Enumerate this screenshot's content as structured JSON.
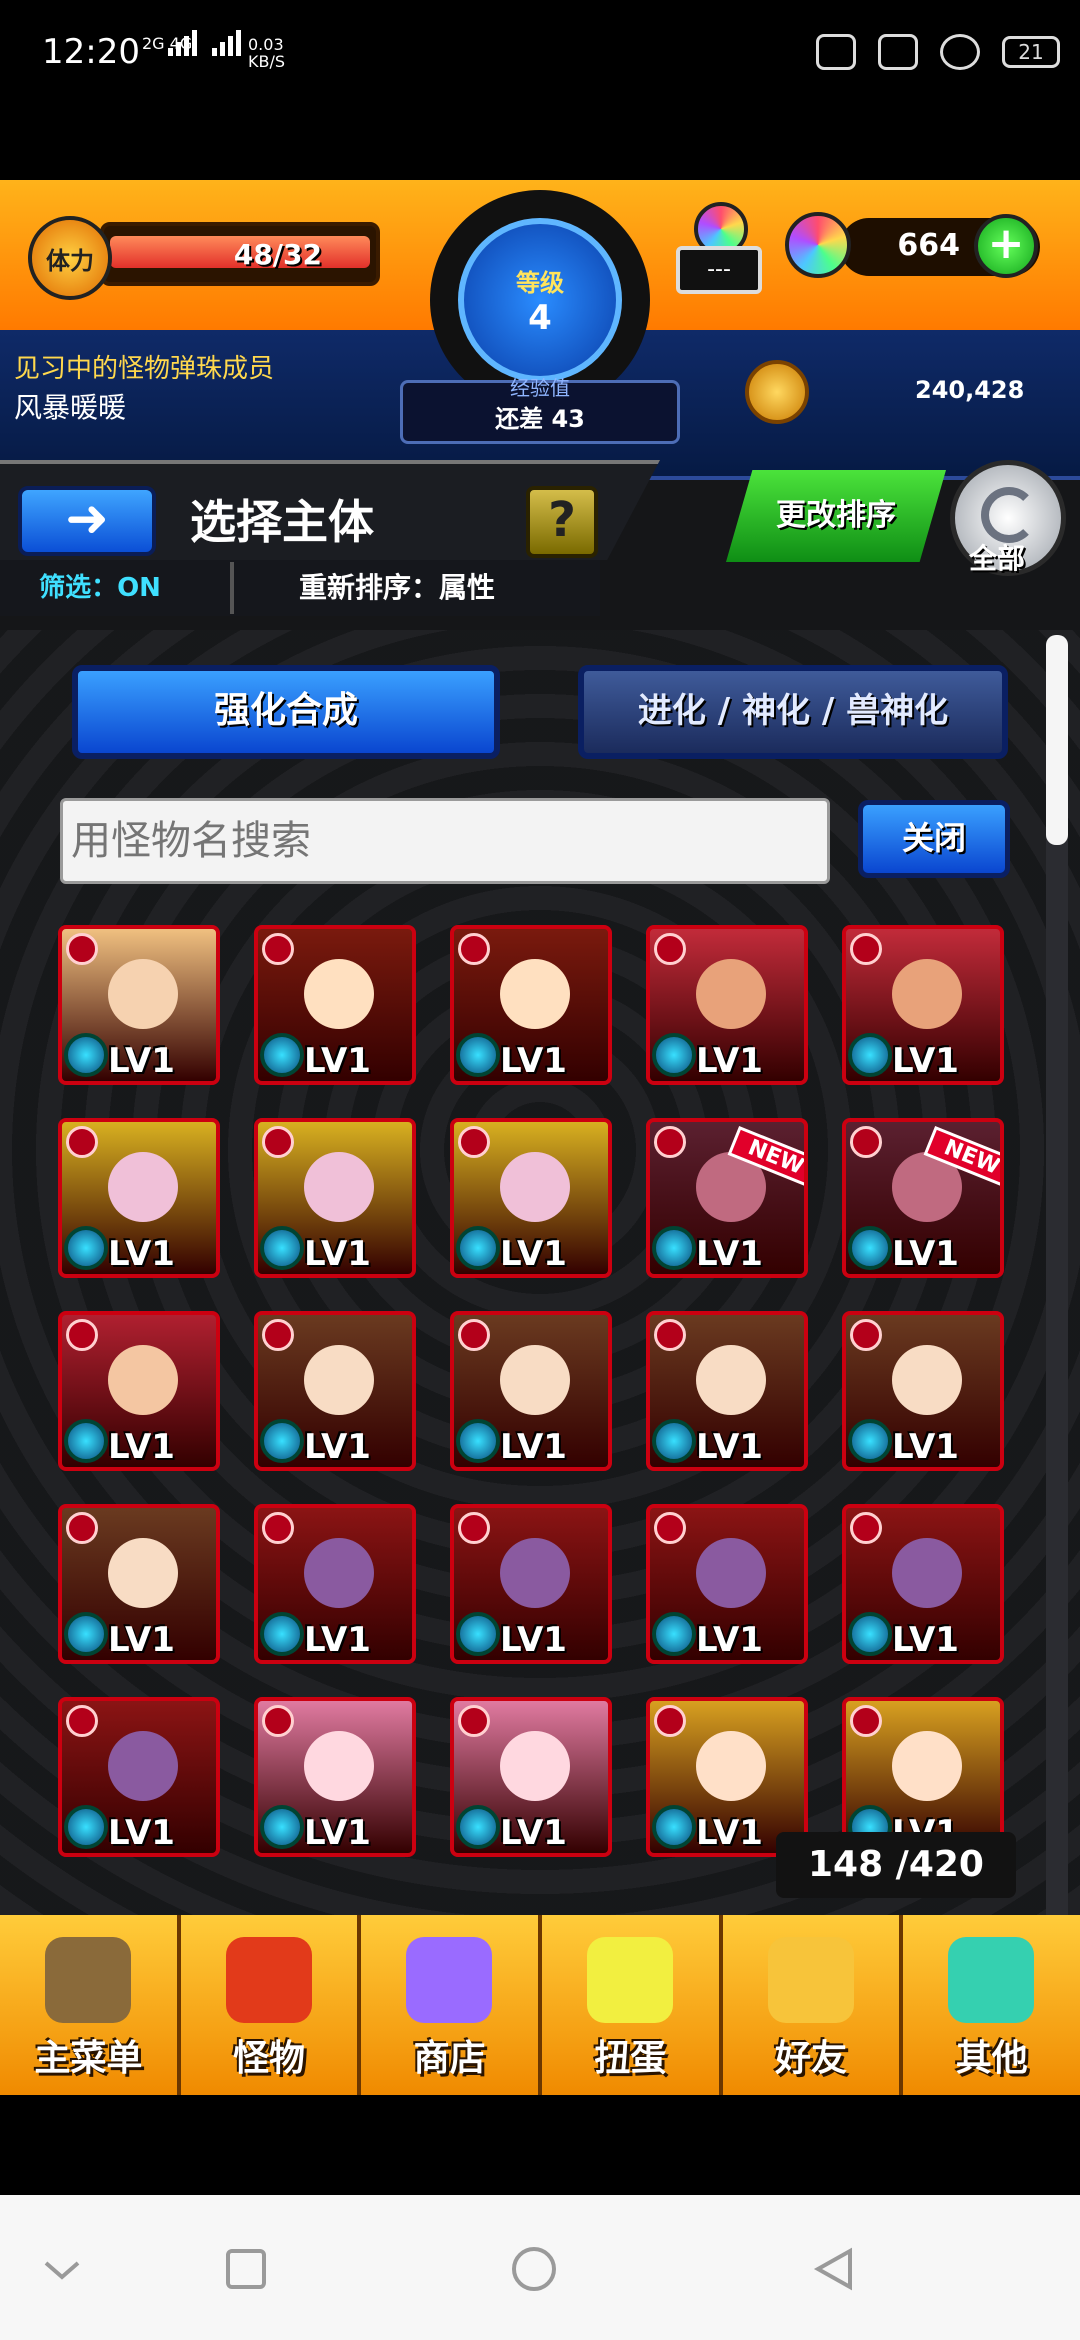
{
  "status_bar": {
    "time": "12:20",
    "network": "2G 4G",
    "speed_value": "0.03",
    "speed_unit": "KB/S",
    "battery": "21"
  },
  "hud": {
    "stamina_label": "体力",
    "stamina_value": "48/32",
    "level_label": "等级",
    "level_value": "4",
    "exp_label": "经验值",
    "exp_value": "还差 43",
    "lock_value": "---",
    "gems": "664",
    "gems_plus": "+",
    "member_title": "见习中的怪物弹珠成员",
    "player_name": "风暴暖暖",
    "coins": "240,428"
  },
  "header": {
    "back_icon": "back-arrow-icon",
    "title": "选择主体",
    "help": "?",
    "filter": "筛选：ON",
    "sort": "重新排序：属性",
    "reorder_button": "更改排序",
    "refresh_label": "全部"
  },
  "tabs": {
    "enhance": "强化合成",
    "evolve": "进化 / 神化 / 兽神化"
  },
  "search": {
    "placeholder": "用怪物名搜索",
    "close": "关闭"
  },
  "monsters": [
    {
      "level": "LV1",
      "bg": "#f0c080",
      "face": "#f6d2b0"
    },
    {
      "level": "LV1",
      "bg": "#7a1a0e",
      "face": "#ffe0c0"
    },
    {
      "level": "LV1",
      "bg": "#7a1a0e",
      "face": "#ffe0c0"
    },
    {
      "level": "LV1",
      "bg": "#c22b3a",
      "face": "#e8a27a"
    },
    {
      "level": "LV1",
      "bg": "#c22b3a",
      "face": "#e8a27a"
    },
    {
      "level": "LV1",
      "bg": "#d8b020",
      "face": "#f0c0d8"
    },
    {
      "level": "LV1",
      "bg": "#d8b020",
      "face": "#f0c0d8"
    },
    {
      "level": "LV1",
      "bg": "#d8b020",
      "face": "#f0c0d8"
    },
    {
      "level": "LV1",
      "bg": "#5b2030",
      "face": "#c06a80",
      "new": "NEW"
    },
    {
      "level": "LV1",
      "bg": "#5b2030",
      "face": "#c06a80",
      "new": "NEW"
    },
    {
      "level": "LV1",
      "bg": "#b02030",
      "face": "#f4c6a2"
    },
    {
      "level": "LV1",
      "bg": "#6a3a20",
      "face": "#f8dcc4"
    },
    {
      "level": "LV1",
      "bg": "#6a3a20",
      "face": "#f8dcc4"
    },
    {
      "level": "LV1",
      "bg": "#6a3a20",
      "face": "#f8dcc4"
    },
    {
      "level": "LV1",
      "bg": "#6a3a20",
      "face": "#f8dcc4"
    },
    {
      "level": "LV1",
      "bg": "#6a3a20",
      "face": "#f8dcc4"
    },
    {
      "level": "LV1",
      "bg": "#8b1414",
      "face": "#8a5aa0"
    },
    {
      "level": "LV1",
      "bg": "#8b1414",
      "face": "#8a5aa0"
    },
    {
      "level": "LV1",
      "bg": "#8b1414",
      "face": "#8a5aa0"
    },
    {
      "level": "LV1",
      "bg": "#8b1414",
      "face": "#8a5aa0"
    },
    {
      "level": "LV1",
      "bg": "#8b1414",
      "face": "#8a5aa0"
    },
    {
      "level": "LV1",
      "bg": "#e07aa0",
      "face": "#ffd8e0"
    },
    {
      "level": "LV1",
      "bg": "#e07aa0",
      "face": "#ffd8e0"
    },
    {
      "level": "LV1",
      "bg": "#d8a020",
      "face": "#ffe0c8"
    },
    {
      "level": "LV1",
      "bg": "#d8a020",
      "face": "#ffe0c8"
    }
  ],
  "box_count": "148 /420",
  "menu": [
    {
      "label": "主菜单",
      "icon": "castle-icon",
      "color": "#8a6a3a"
    },
    {
      "label": "怪物",
      "icon": "monster-icon",
      "color": "#e23a1a"
    },
    {
      "label": "商店",
      "icon": "rainbow-orb-icon",
      "color": "#9a6bff"
    },
    {
      "label": "扭蛋",
      "icon": "gacha-egg-icon",
      "color": "#f2ef40"
    },
    {
      "label": "好友",
      "icon": "friends-icon",
      "color": "#f7c43a"
    },
    {
      "label": "其他",
      "icon": "others-icon",
      "color": "#35d0b0"
    }
  ]
}
